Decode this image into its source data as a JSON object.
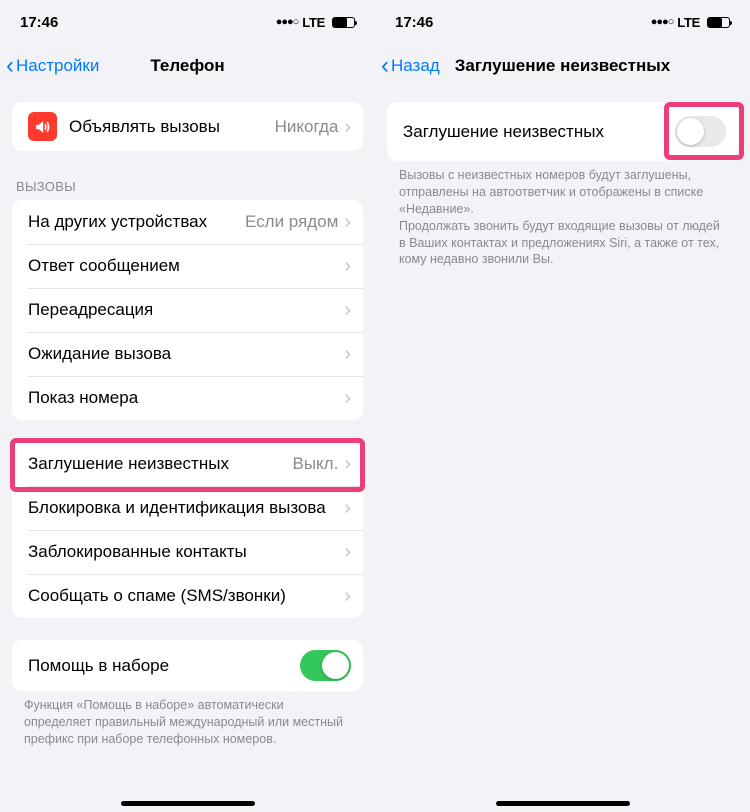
{
  "left": {
    "status": {
      "time": "17:46",
      "network": "LTE"
    },
    "nav": {
      "back": "Настройки",
      "title": "Телефон"
    },
    "announce": {
      "label": "Объявлять вызовы",
      "value": "Никогда"
    },
    "calls_header": "ВЫЗОВЫ",
    "calls": [
      {
        "label": "На других устройствах",
        "value": "Если рядом"
      },
      {
        "label": "Ответ сообщением",
        "value": ""
      },
      {
        "label": "Переадресация",
        "value": ""
      },
      {
        "label": "Ожидание вызова",
        "value": ""
      },
      {
        "label": "Показ номера",
        "value": ""
      }
    ],
    "block": [
      {
        "label": "Заглушение неизвестных",
        "value": "Выкл."
      },
      {
        "label": "Блокировка и идентификация вызова",
        "value": ""
      },
      {
        "label": "Заблокированные контакты",
        "value": ""
      },
      {
        "label": "Сообщать о спаме (SMS/звонки)",
        "value": ""
      }
    ],
    "dialassist": {
      "label": "Помощь в наборе"
    },
    "dialassist_note": "Функция «Помощь в наборе» автоматически определяет правильный международный или местный префикс при наборе телефонных номеров."
  },
  "right": {
    "status": {
      "time": "17:46",
      "network": "LTE"
    },
    "nav": {
      "back": "Назад",
      "title": "Заглушение неизвестных"
    },
    "row": {
      "label": "Заглушение неизвестных"
    },
    "note": "Вызовы с неизвестных номеров будут заглушены, отправлены на автоответчик и отображены в списке «Недавние».\nПродолжать звонить будут входящие вызовы от людей в Ваших контактах и предложениях Siri, а также от тех, кому недавно звонили Вы."
  }
}
